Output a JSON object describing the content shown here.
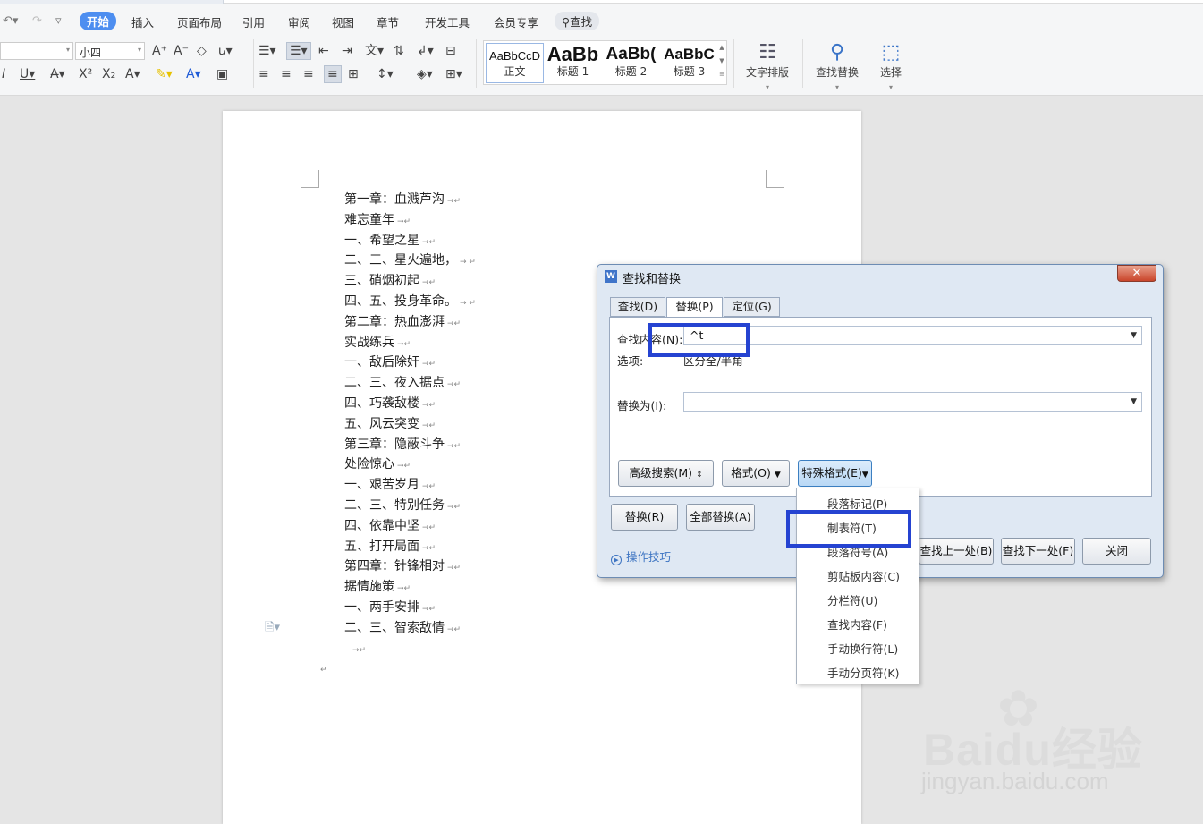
{
  "menubar": {
    "items": [
      "开始",
      "插入",
      "页面布局",
      "引用",
      "审阅",
      "视图",
      "章节",
      "开发工具",
      "会员专享"
    ],
    "search_label": "查找"
  },
  "font": {
    "family_value": "",
    "size_value": "小四"
  },
  "styles": [
    {
      "preview": "AaBbCcD",
      "label": "正文"
    },
    {
      "preview": "AaBb",
      "label": "标题 1"
    },
    {
      "preview": "AaBb(",
      "label": "标题 2"
    },
    {
      "preview": "AaBbC",
      "label": "标题 3"
    }
  ],
  "ribbon_buttons": {
    "text_layout": "文字排版",
    "find_replace": "查找替换",
    "select": "选择"
  },
  "document": {
    "lines": [
      "第一章：血溅芦沟",
      "难忘童年",
      "一、希望之星",
      "二、三、星火遍地，",
      "三、硝烟初起",
      "四、五、投身革命。",
      "第二章：热血澎湃",
      "实战练兵",
      "一、敌后除奸",
      "二、三、夜入据点",
      "四、巧袭敌楼",
      "五、风云突变",
      "第三章：隐蔽斗争",
      "处险惊心",
      "一、艰苦岁月",
      "二、三、特别任务",
      "四、依靠中坚",
      "五、打开局面",
      "第四章：针锋相对",
      "据情施策",
      "一、两手安排",
      "二、三、智索敌情",
      "",
      ""
    ],
    "line_marks": [
      "→↵",
      "→↵",
      "→↵",
      "→ ↵",
      "→↵",
      "→ ↵",
      "→↵",
      "→↵",
      "→↵",
      "→↵",
      "→↵",
      "→↵",
      "→↵",
      "→↵",
      "→↵",
      "→↵",
      "→↵",
      "→↵",
      "→↵",
      "→↵",
      "→↵",
      "→↵",
      "→↵",
      "↵"
    ]
  },
  "dialog": {
    "title": "查找和替换",
    "tabs": [
      "查找(D)",
      "替换(P)",
      "定位(G)"
    ],
    "active_tab": "替换(P)",
    "find_label": "查找内容(N):",
    "find_value": "^t",
    "options_label": "选项:",
    "options_value": "区分全/半角",
    "replace_label": "替换为(I):",
    "replace_value": "",
    "buttons": {
      "advanced": "高级搜索(M)",
      "format": "格式(O)",
      "special": "特殊格式(E)",
      "replace": "替换(R)",
      "replace_all": "全部替换(A)",
      "find_prev": "查找上一处(B)",
      "find_next": "查找下一处(F)",
      "close": "关闭"
    },
    "tips": "操作技巧"
  },
  "special_menu": {
    "items": [
      "段落标记(P)",
      "制表符(T)",
      "段落符号(A)",
      "剪贴板内容(C)",
      "分栏符(U)",
      "查找内容(F)",
      "手动换行符(L)",
      "手动分页符(K)"
    ]
  },
  "watermark": {
    "brand": "Baidu经验",
    "url": "jingyan.baidu.com"
  },
  "colors": {
    "accent": "#4d8ef0",
    "highlight_box": "#2543d1",
    "dialog_bg": "#dfe8f3"
  }
}
